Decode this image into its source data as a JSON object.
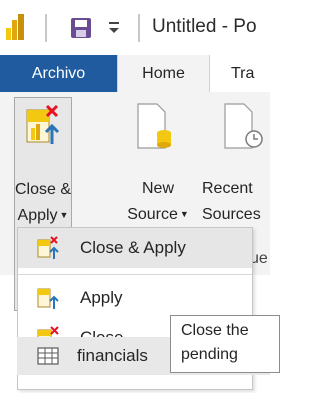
{
  "window": {
    "title": "Untitled - Po"
  },
  "ribbon": {
    "tabs": [
      {
        "label": "Archivo"
      },
      {
        "label": "Home"
      },
      {
        "label": "Tra"
      }
    ],
    "close_apply": {
      "line1": "Close &",
      "line2": "Apply"
    },
    "new_source": {
      "line1": "New",
      "line2": "Source"
    },
    "recent_sources": {
      "line1": "Recent",
      "line2": "Sources"
    },
    "partial_group_label": "ue"
  },
  "dropdown": {
    "items": [
      {
        "label": "Close & Apply"
      },
      {
        "label": "Apply"
      },
      {
        "label": "Close"
      }
    ]
  },
  "tooltip": {
    "line1": "Close the",
    "line2": "pending"
  },
  "fields": {
    "table_name": "financials"
  },
  "colors": {
    "file_tab": "#1f5b9e",
    "accent_yellow": "#f2c811",
    "close_red": "#e81123",
    "arrow_blue": "#2b74b8",
    "save_purple": "#6a4c93"
  }
}
